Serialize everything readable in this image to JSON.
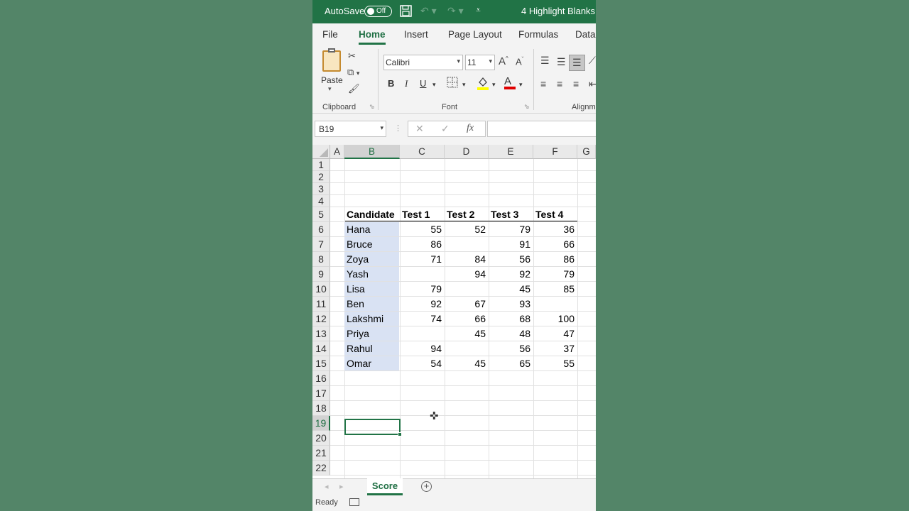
{
  "titlebar": {
    "autosave_label": "AutoSave",
    "autosave_state": "Off",
    "doc_title": "4 Highlight Blanks",
    "title_caret": "▾"
  },
  "tabs": [
    "File",
    "Home",
    "Insert",
    "Page Layout",
    "Formulas",
    "Data"
  ],
  "ribbon": {
    "paste_label": "Paste",
    "clipboard_label": "Clipboard",
    "font_label": "Font",
    "alignment_label": "Alignm",
    "font_name": "Calibri",
    "font_size": "11",
    "bold": "B",
    "italic": "I",
    "underline": "U",
    "font_color_letter": "A",
    "grow_font": "A",
    "shrink_font": "A",
    "accent_highlight": "#ffff00",
    "accent_font_color": "#e00000"
  },
  "formula_bar": {
    "name_box": "B19",
    "cancel": "✕",
    "enter": "✓",
    "fx": "fx",
    "formula": ""
  },
  "columns": [
    "A",
    "B",
    "C",
    "D",
    "E",
    "F",
    "G"
  ],
  "rows": [
    "1",
    "2",
    "3",
    "4",
    "5",
    "6",
    "7",
    "8",
    "9",
    "10",
    "11",
    "12",
    "13",
    "14",
    "15",
    "16",
    "17",
    "18",
    "19",
    "20",
    "21",
    "22"
  ],
  "table": {
    "headers": [
      "Candidate",
      "Test 1",
      "Test 2",
      "Test 3",
      "Test 4"
    ],
    "rows": [
      [
        "Hana",
        "55",
        "52",
        "79",
        "36"
      ],
      [
        "Bruce",
        "86",
        "",
        "91",
        "66"
      ],
      [
        "Zoya",
        "71",
        "84",
        "56",
        "86"
      ],
      [
        "Yash",
        "",
        "94",
        "92",
        "79"
      ],
      [
        "Lisa",
        "79",
        "",
        "45",
        "85"
      ],
      [
        "Ben",
        "92",
        "67",
        "93",
        ""
      ],
      [
        "Lakshmi",
        "74",
        "66",
        "68",
        "100"
      ],
      [
        "Priya",
        "",
        "45",
        "48",
        "47"
      ],
      [
        "Rahul",
        "94",
        "",
        "56",
        "37"
      ],
      [
        "Omar",
        "54",
        "45",
        "65",
        "55"
      ]
    ],
    "name_highlight": "#d9e2f3"
  },
  "sheet": {
    "active_tab": "Score",
    "add_sheet": "+"
  },
  "status": {
    "text": "Ready"
  },
  "colors": {
    "excel_green": "#217346",
    "background": "#538568"
  }
}
